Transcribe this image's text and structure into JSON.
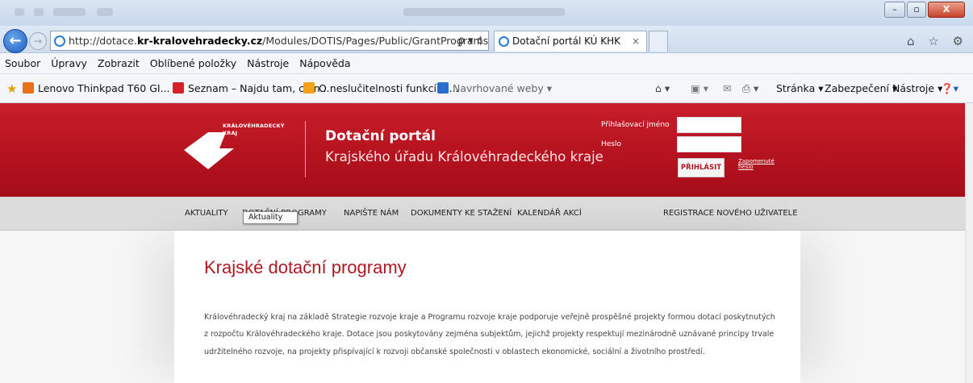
{
  "browser": {
    "address_prefix": "http://dotace.",
    "address_domain": "kr-kralovehradecky.cz",
    "address_path": "/Modules/DOTIS/Pages/Public/GrantPrograms.aspx",
    "address_controls": "ρ ▾ ¢",
    "tab_title": "Dotační portál KÚ KHK",
    "tab_close": "×",
    "right_icons": "⌂ ☆ ⚙",
    "win_min": "–",
    "win_max": "▫",
    "win_close": "X"
  },
  "menu": [
    "Soubor",
    "Úpravy",
    "Zobrazit",
    "Oblíbené položky",
    "Nástroje",
    "Nápověda"
  ],
  "favorites": {
    "items": [
      "Lenovo Thinkpad T60 GI...",
      "Seznam – Najdu tam, co n...",
      "O neslučitelnosti funkcí a ...",
      "Navrhované weby ▾"
    ],
    "colors": [
      "#e8721c",
      "#d6202a",
      "#f3a01c",
      "#2a6fd0"
    ]
  },
  "commandbar": [
    "Stránka ▾",
    "Zabezpečení ▾",
    "Nástroje ▾"
  ],
  "site": {
    "logo_text": "KRÁLOVÉHRADECKÝ\nKRAJ",
    "title": "Dotační portál",
    "subtitle": "Krajského úřadu Královéhradeckého kraje",
    "login_label": "Přihlašovací jméno",
    "password_label": "Heslo",
    "login_button": "PŘIHLÁSIT",
    "forgot_password": "Zapomenuté heslo",
    "accent": "#b3121e"
  },
  "nav": {
    "items": [
      "AKTUALITY",
      "DOTAČNÍ PROGRAMY",
      "NAPIŠTE NÁM",
      "DOKUMENTY KE STAŽENÍ",
      "KALENDÁŘ AKCÍ"
    ],
    "register": "REGISTRACE NOVÉHO UŽIVATELE",
    "tooltip": "Aktuality"
  },
  "main": {
    "heading": "Krajské dotační programy",
    "lines": [
      "Královéhradecký kraj na základě Strategie rozvoje kraje a Programu rozvoje kraje podporuje veřejně prospěšné projekty formou dotací poskytnutých",
      "z rozpočtu Královéhradeckého kraje. Dotace jsou poskytovány zejména subjektům, jejichž projekty respektují mezinárodně uznávané principy trvale",
      "udržitelného rozvoje, na projekty přispívající k rozvoji občanské společnosti v oblastech ekonomické, sociální a životního prostředí."
    ]
  }
}
